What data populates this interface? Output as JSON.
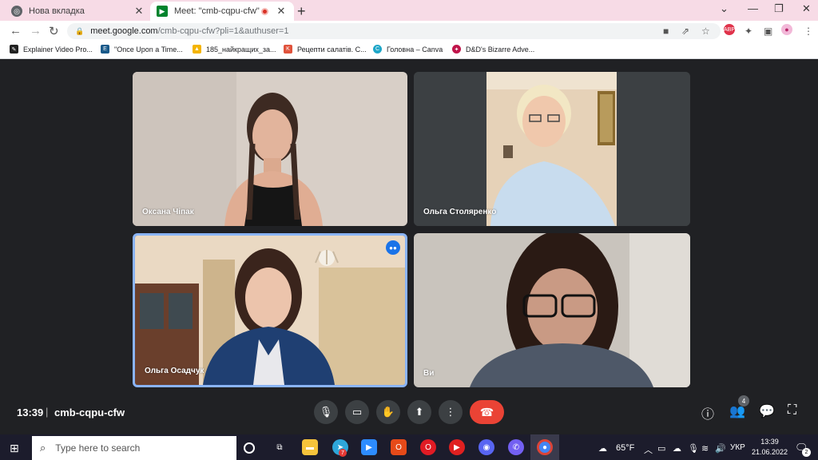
{
  "browser": {
    "tabs": [
      {
        "title": "Нова вкладка",
        "active": false
      },
      {
        "title": "Meet: \"cmb-cqpu-cfw\"",
        "active": true
      }
    ],
    "url_host": "meet.google.com",
    "url_path": "/cmb-cqpu-cfw?pli=1&authuser=1",
    "abp_label": "ABP",
    "bookmarks": [
      {
        "label": "Explainer Video Pro...",
        "icon": "explainer-icon",
        "color": "#222222"
      },
      {
        "label": "\"Once Upon a Time...",
        "icon": "e-icon",
        "color": "#1a5a8a"
      },
      {
        "label": "185_найкращих_за...",
        "icon": "drive-icon",
        "color": "#f4b400"
      },
      {
        "label": "Рецепти салатів. С...",
        "icon": "k-icon",
        "color": "#e0533c"
      },
      {
        "label": "Головна – Canva",
        "icon": "canva-icon",
        "color": "#1ea6c8"
      },
      {
        "label": "D&D's Bizarre Adve...",
        "icon": "dnd-icon",
        "color": "#c0144a"
      }
    ]
  },
  "meet": {
    "participants": [
      {
        "name": "Оксана Чіпак",
        "speaking": false
      },
      {
        "name": "Ольга Столяренко",
        "speaking": false
      },
      {
        "name": "Ольга Осадчук",
        "speaking": true
      },
      {
        "name": "Ви",
        "speaking": false
      }
    ],
    "time": "13:39",
    "separator": "|",
    "meeting_code": "cmb-cqpu-cfw",
    "participant_count": "4",
    "accent_color": "#8ab4f8",
    "hangup_color": "#ea4335"
  },
  "taskbar": {
    "search_placeholder": "Type here to search",
    "weather": "65°F",
    "language": "УКР",
    "clock_time": "13:39",
    "clock_date": "21.06.2022",
    "telegram_badge": "7",
    "notification_count": "2"
  }
}
